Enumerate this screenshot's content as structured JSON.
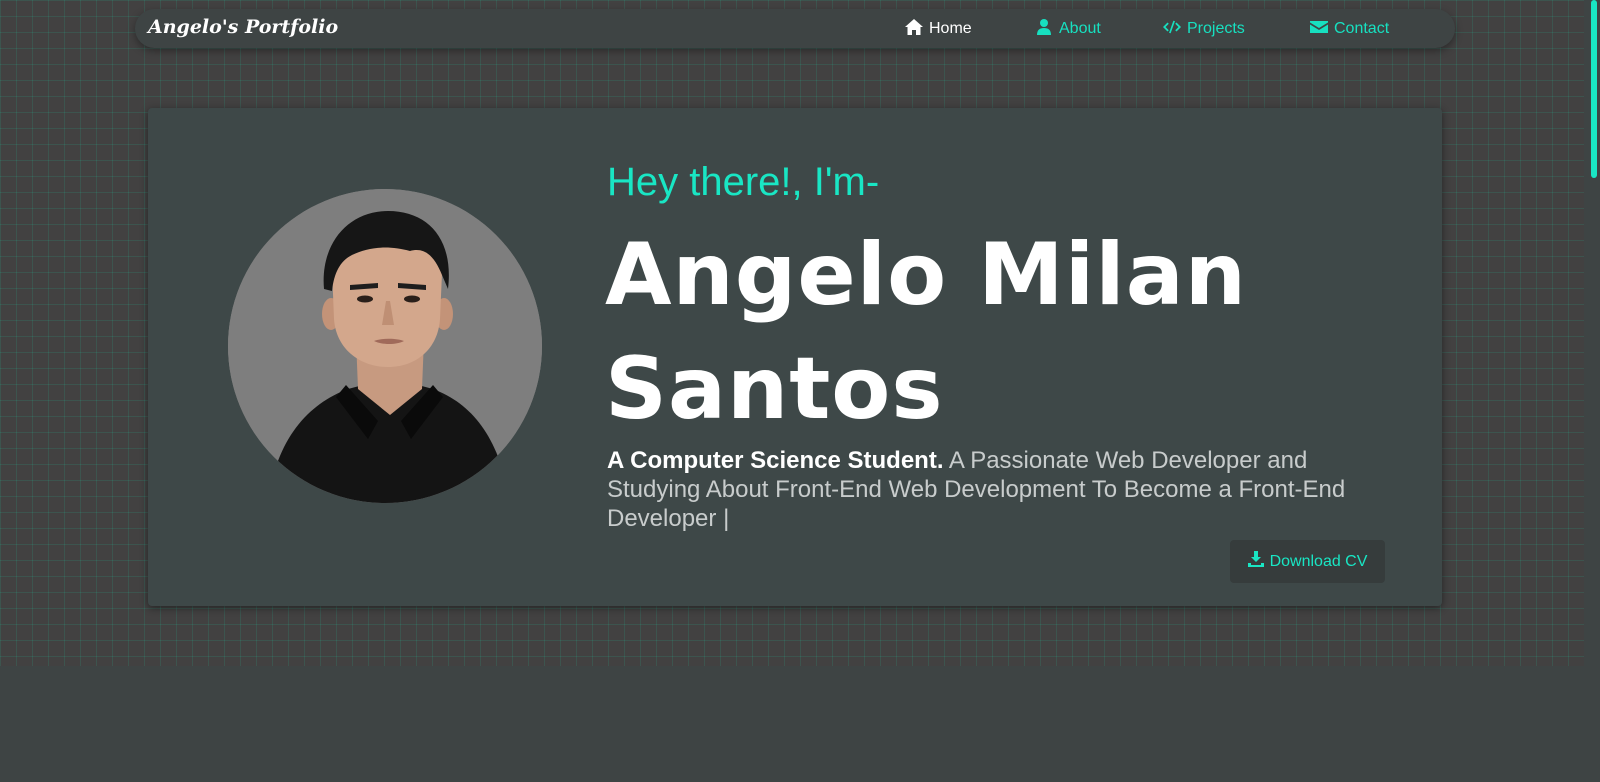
{
  "brand": "Angelo's Portfolio",
  "nav": {
    "items": [
      {
        "label": "Home",
        "icon": "home-icon",
        "active": true
      },
      {
        "label": "About",
        "icon": "user-icon",
        "active": false
      },
      {
        "label": "Projects",
        "icon": "code-icon",
        "active": false
      },
      {
        "label": "Contact",
        "icon": "envelope-icon",
        "active": false
      }
    ]
  },
  "hero": {
    "greeting": "Hey there!, I'm-",
    "name": "Angelo Milan Santos",
    "bio_lead": "A Computer Science Student.",
    "bio_rest": " A Passionate Web Developer and Studying About Front-End Web Development To Become a Front-End Developer |",
    "download_label": "Download CV",
    "download_icon": "download-icon",
    "avatar_alt": "profile-photo"
  },
  "colors": {
    "accent": "#19e6c4",
    "background": "#3e4444",
    "card": "#3e4848",
    "text": "#ffffff"
  }
}
